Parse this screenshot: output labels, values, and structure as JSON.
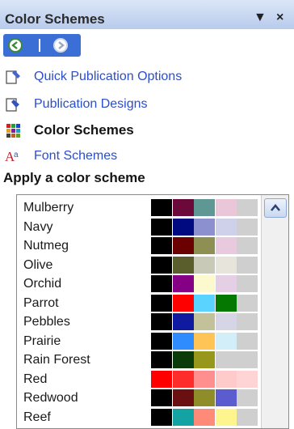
{
  "pane": {
    "title": "Color Schemes",
    "dropdown_glyph": "▼",
    "close_glyph": "×"
  },
  "nav": {
    "back_icon": "back-arrow-icon",
    "forward_icon": "forward-arrow-icon"
  },
  "links": [
    {
      "label": "Quick Publication Options",
      "icon": "quick-options-icon",
      "active": false
    },
    {
      "label": "Publication Designs",
      "icon": "publication-designs-icon",
      "active": false
    },
    {
      "label": "Color Schemes",
      "icon": "color-schemes-icon",
      "active": true
    },
    {
      "label": "Font Schemes",
      "icon": "font-schemes-icon",
      "active": false
    }
  ],
  "section_title": "Apply a color scheme",
  "schemes": [
    {
      "name": "Mulberry",
      "colors": [
        "#000000",
        "#6b0a3a",
        "#5e9794",
        "#eac7d8",
        "#cfcfcf"
      ]
    },
    {
      "name": "Navy",
      "colors": [
        "#000000",
        "#000a80",
        "#8c90cf",
        "#cfd1ea",
        "#cfcfcf"
      ]
    },
    {
      "name": "Nutmeg",
      "colors": [
        "#000000",
        "#6a0000",
        "#8d8f53",
        "#e9c9de",
        "#cfcfcf"
      ]
    },
    {
      "name": "Olive",
      "colors": [
        "#000000",
        "#5a5d2c",
        "#c9c9b7",
        "#e7e4dc",
        "#cfcfcf"
      ]
    },
    {
      "name": "Orchid",
      "colors": [
        "#000000",
        "#860085",
        "#fdf9cf",
        "#e5cfe4",
        "#cfcfcf"
      ]
    },
    {
      "name": "Parrot",
      "colors": [
        "#000000",
        "#ff0000",
        "#5ad3ff",
        "#047800",
        "#cfcfcf"
      ]
    },
    {
      "name": "Pebbles",
      "colors": [
        "#000000",
        "#101aa0",
        "#c2c19a",
        "#d5d5e6",
        "#cfcfcf"
      ]
    },
    {
      "name": "Prairie",
      "colors": [
        "#000000",
        "#2f8cff",
        "#fec455",
        "#d2eef9",
        "#cfcfcf"
      ]
    },
    {
      "name": "Rain Forest",
      "colors": [
        "#000000",
        "#0c3b0a",
        "#97971c",
        "#cfcfcf",
        "#cfcfcf"
      ]
    },
    {
      "name": "Red",
      "colors": [
        "#ff0000",
        "#ff2c2c",
        "#ff8f8f",
        "#ffcaca",
        "#ffd4d4"
      ]
    },
    {
      "name": "Redwood",
      "colors": [
        "#000000",
        "#6b1010",
        "#8f8d2a",
        "#5a5ccf",
        "#cfcfcf"
      ]
    },
    {
      "name": "Reef",
      "colors": [
        "#000000",
        "#13a3a2",
        "#ff8a78",
        "#fff58f",
        "#cfcfcf"
      ]
    }
  ],
  "scrollbar": {
    "up_icon": "chevron-up-icon"
  }
}
